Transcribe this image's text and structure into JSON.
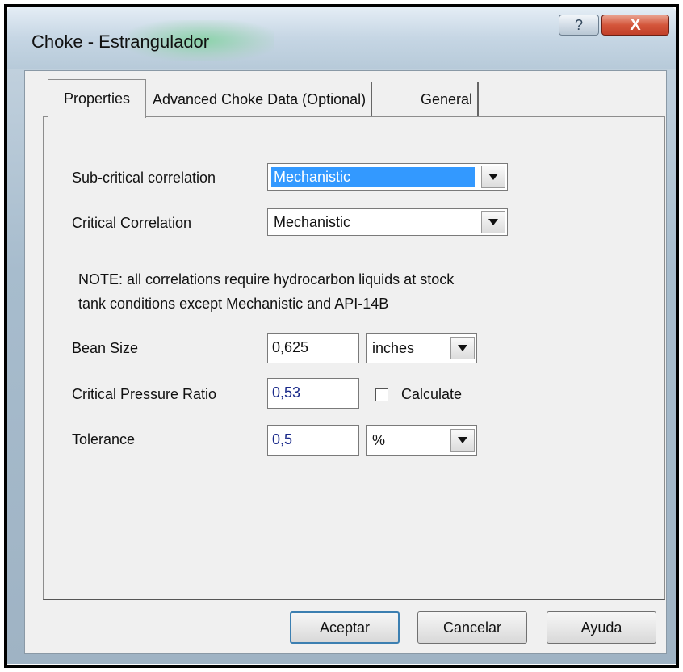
{
  "window": {
    "title": "Choke - Estrangulador",
    "help_button_label": "?",
    "close_button_label": "X"
  },
  "tabs": [
    {
      "label": "Properties",
      "active": true
    },
    {
      "label": "Advanced Choke Data (Optional)",
      "active": false
    },
    {
      "label": "General",
      "active": false
    }
  ],
  "form": {
    "subcritical_label": "Sub-critical correlation",
    "subcritical_value": "Mechanistic",
    "critical_label": "Critical Correlation",
    "critical_value": "Mechanistic",
    "note_line1": "NOTE: all correlations require hydrocarbon liquids at stock",
    "note_line2": "tank conditions except Mechanistic and API-14B",
    "bean_size_label": "Bean Size",
    "bean_size_value": "0,625",
    "bean_size_unit": "inches",
    "pressure_ratio_label": "Critical Pressure Ratio",
    "pressure_ratio_value": "0,53",
    "calculate_label": "Calculate",
    "calculate_checked": false,
    "tolerance_label": "Tolerance",
    "tolerance_value": "0,5",
    "tolerance_unit": "%"
  },
  "buttons": {
    "ok": "Aceptar",
    "cancel": "Cancelar",
    "help": "Ayuda"
  }
}
